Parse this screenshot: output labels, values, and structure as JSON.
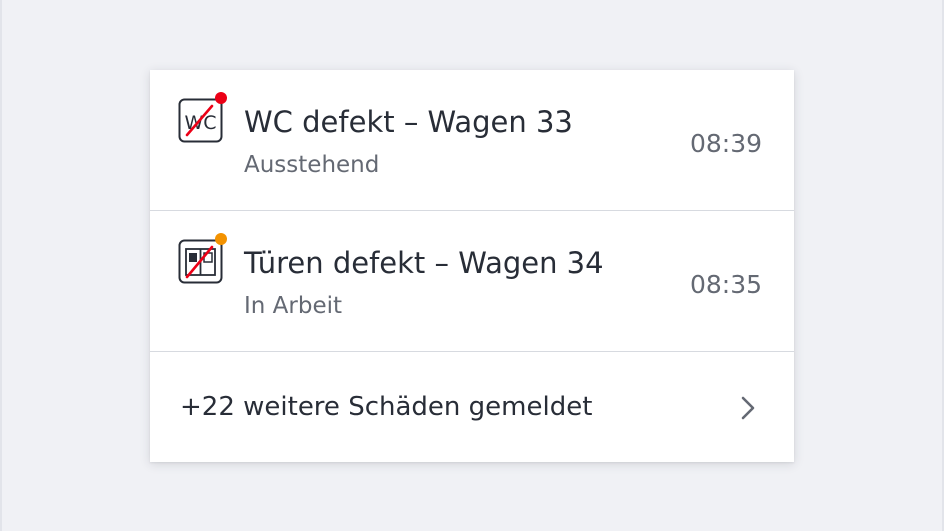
{
  "colors": {
    "background": "#f0f1f5",
    "card": "#ffffff",
    "text_primary": "#282d37",
    "text_secondary": "#646973",
    "status_pending": "#ec0016",
    "status_in_progress": "#f39200",
    "strike": "#ec0016"
  },
  "reports": [
    {
      "icon": "wc-defect-icon",
      "status_color": "#ec0016",
      "title": "WC defekt – Wagen 33",
      "status": "Ausstehend",
      "time": "08:39"
    },
    {
      "icon": "door-defect-icon",
      "status_color": "#f39200",
      "title": "Türen defekt – Wagen 34",
      "status": "In Arbeit",
      "time": "08:35"
    }
  ],
  "footer": {
    "label": "+22 weitere Schäden gemeldet",
    "icon": "chevron-right-icon"
  }
}
